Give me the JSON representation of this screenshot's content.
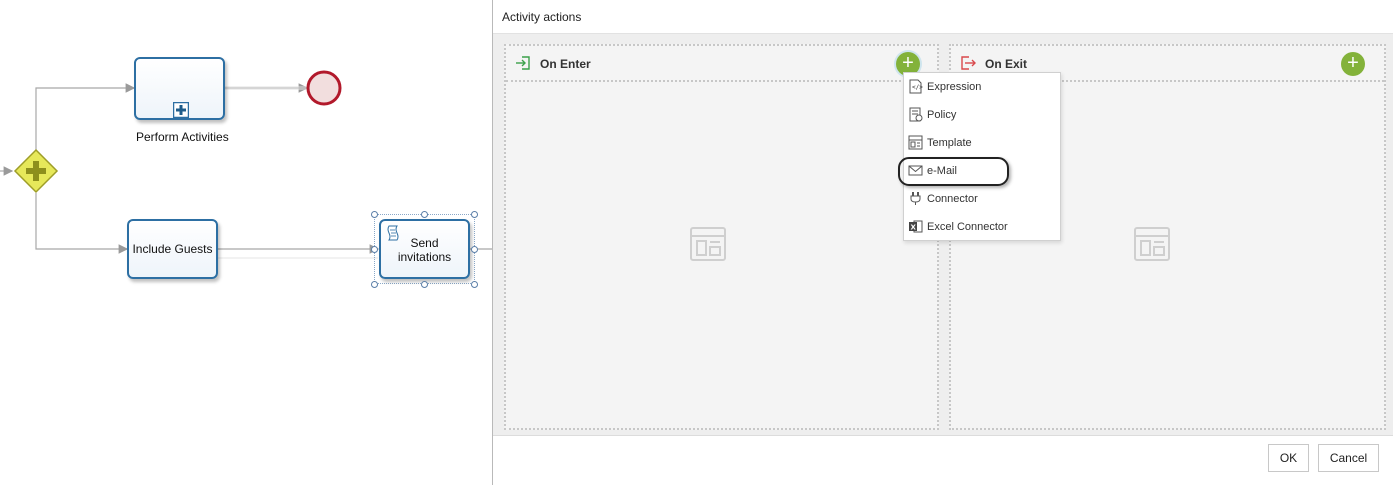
{
  "diagram": {
    "tasks": [
      {
        "label": "Include Guests"
      },
      {
        "label": "Send invitations"
      }
    ],
    "subprocess_caption": "Perform Activities"
  },
  "dialog": {
    "title": "Activity actions",
    "on_enter": {
      "title": "On Enter",
      "add_icon": "+"
    },
    "on_exit": {
      "title": "On Exit",
      "add_icon": "+"
    },
    "ok_label": "OK",
    "cancel_label": "Cancel"
  },
  "menu": {
    "items": [
      {
        "label": "Expression",
        "icon": "expression-icon"
      },
      {
        "label": "Policy",
        "icon": "policy-icon"
      },
      {
        "label": "Template",
        "icon": "template-icon"
      },
      {
        "label": "e-Mail",
        "icon": "mail-icon"
      },
      {
        "label": "Connector",
        "icon": "connector-icon"
      },
      {
        "label": "Excel Connector",
        "icon": "excel-icon"
      }
    ],
    "highlighted_item": "e-Mail"
  },
  "colors": {
    "task_border": "#2d6fa3",
    "gateway_fill": "#e6e85a",
    "end_event": "#b2192b",
    "add_button": "#83b23a",
    "enter_icon": "#3aa04a",
    "exit_icon": "#d9484b"
  }
}
